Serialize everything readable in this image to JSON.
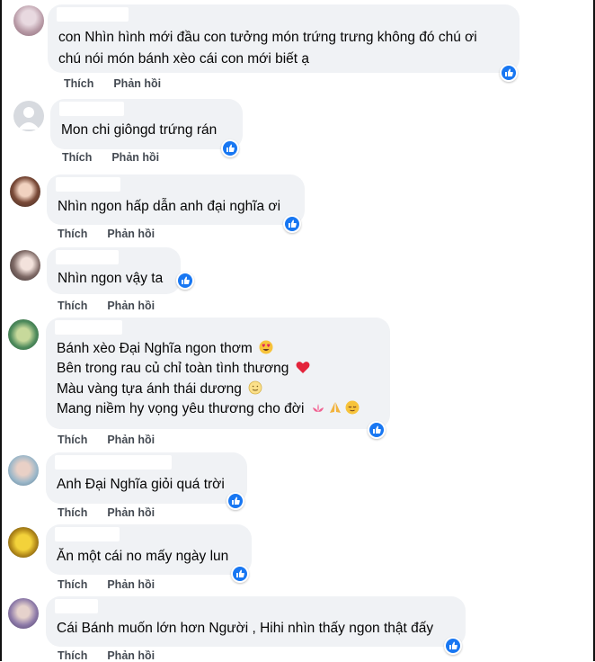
{
  "actions": {
    "like_label": "Thích",
    "reply_label": "Phản hồi"
  },
  "comments": [
    {
      "lines": [
        "con Nhìn hình mới đầu con tưởng món trứng trưng không đó chú ơi",
        "chú nói món bánh xèo cái con mới biết ạ"
      ]
    },
    {
      "lines": [
        "Mon chi giôngd trứng rán"
      ]
    },
    {
      "lines": [
        "Nhìn ngon hấp dẫn anh đại nghĩa ơi"
      ]
    },
    {
      "lines": [
        "Nhìn ngon vậy ta"
      ]
    },
    {
      "lines": [
        "Bánh xèo Đại Nghĩa ngon thơm",
        "Bên trong rau củ chỉ toàn tình thương",
        "Màu vàng tựa ánh thái dương",
        "Mang niềm hy vọng yêu thương cho đời"
      ],
      "emojis": [
        "heart-eyes-emoji",
        "red-heart-emoji",
        "smiling-face-emoji",
        "lotus-emoji",
        "folded-hands-emoji",
        "relieved-face-emoji"
      ]
    },
    {
      "lines": [
        "Anh Đại Nghĩa giỏi quá trời"
      ]
    },
    {
      "lines": [
        "Ăn một cái no mấy ngày lun"
      ]
    },
    {
      "lines": [
        "Cái Bánh muốn lớn hơn Người , Hihi nhìn thấy ngon thật đấy"
      ]
    }
  ],
  "colors": {
    "bubble": "#f0f2f5",
    "like_blue": "#1877f2",
    "action_text": "#444a52"
  }
}
